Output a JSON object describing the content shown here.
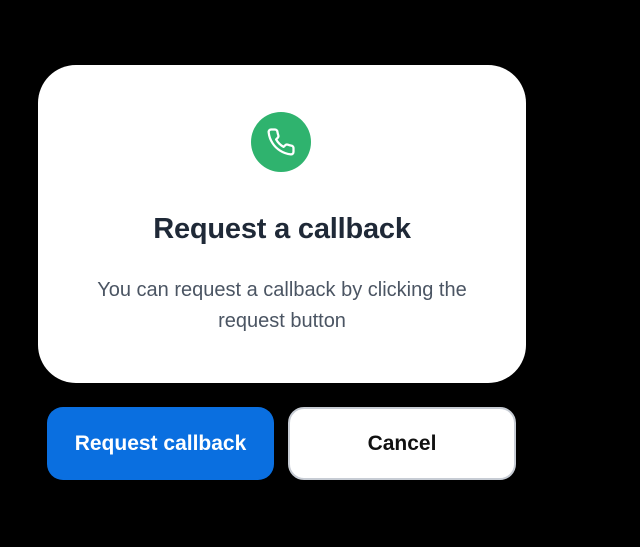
{
  "dialog": {
    "icon": "phone-icon",
    "title": "Request a callback",
    "description": "You can request a callback by clicking the request button",
    "primary_button_label": "Request callback",
    "secondary_button_label": "Cancel"
  },
  "colors": {
    "background": "#000000",
    "card": "#ffffff",
    "icon_badge": "#2fb36e",
    "primary_button": "#0a6fe0",
    "title_text": "#1f2937",
    "body_text": "#4b5563"
  }
}
